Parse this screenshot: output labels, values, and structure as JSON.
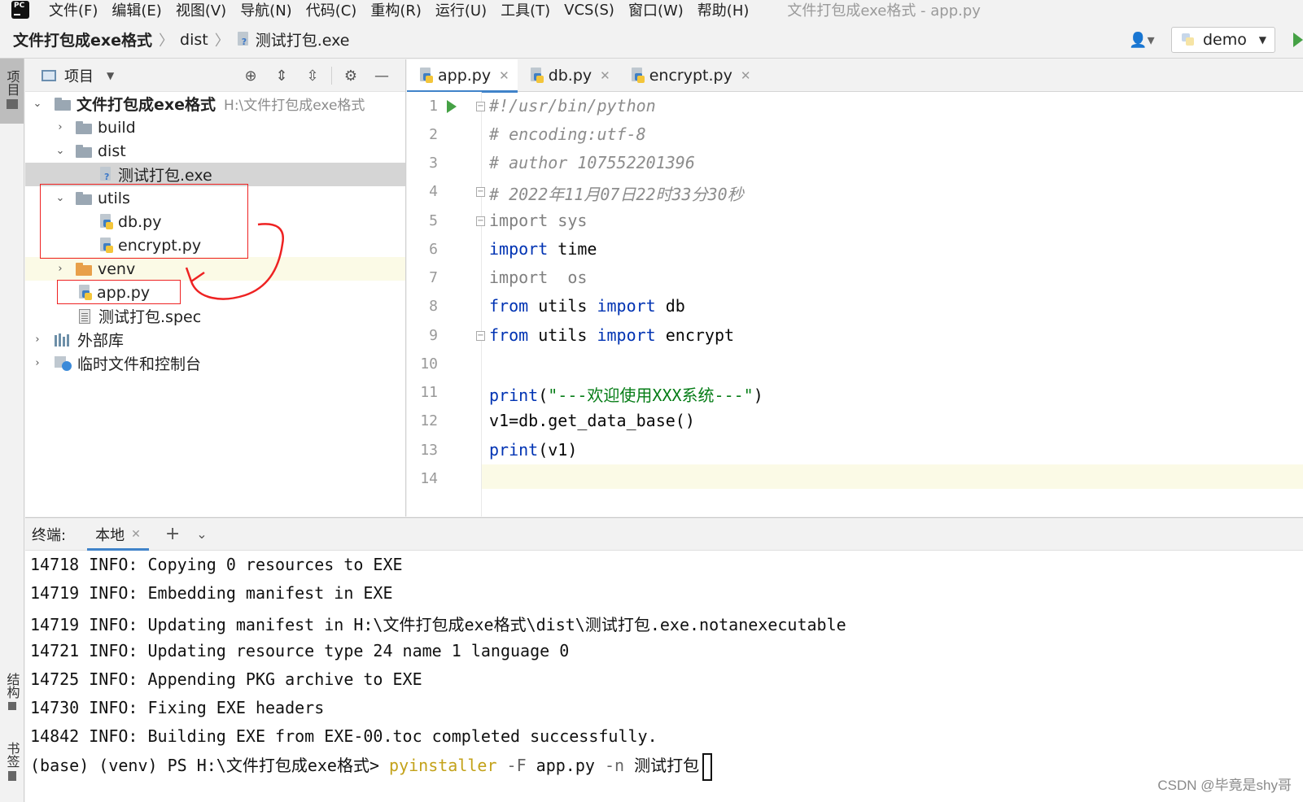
{
  "menu": {
    "logo_text": "PC",
    "items": [
      "文件(F)",
      "编辑(E)",
      "视图(V)",
      "导航(N)",
      "代码(C)",
      "重构(R)",
      "运行(U)",
      "工具(T)",
      "VCS(S)",
      "窗口(W)",
      "帮助(H)"
    ],
    "window_title": "文件打包成exe格式 - app.py"
  },
  "breadcrumb": {
    "project": "文件打包成exe格式",
    "folder": "dist",
    "file": "测试打包.exe"
  },
  "run_config": {
    "label": "demo"
  },
  "left_stripe": {
    "project_tab": "项目",
    "structure_tab": "结构",
    "bookmarks_tab": "书签"
  },
  "project_panel": {
    "title": "项目",
    "tree": [
      {
        "label": "文件打包成exe格式",
        "path": "H:\\文件打包成exe格式"
      },
      {
        "label": "build"
      },
      {
        "label": "dist"
      },
      {
        "label": "测试打包.exe"
      },
      {
        "label": "utils"
      },
      {
        "label": "db.py"
      },
      {
        "label": "encrypt.py"
      },
      {
        "label": "venv"
      },
      {
        "label": "app.py"
      },
      {
        "label": "测试打包.spec"
      },
      {
        "label": "外部库"
      },
      {
        "label": "临时文件和控制台"
      }
    ]
  },
  "editor": {
    "tabs": [
      {
        "label": "app.py",
        "active": true
      },
      {
        "label": "db.py",
        "active": false
      },
      {
        "label": "encrypt.py",
        "active": false
      }
    ],
    "line_numbers": [
      "1",
      "2",
      "3",
      "4",
      "5",
      "6",
      "7",
      "8",
      "9",
      "10",
      "11",
      "12",
      "13",
      "14"
    ],
    "code": {
      "l1": "#!/usr/bin/python",
      "l2": "# encoding:utf-8",
      "l3": "# author 107552201396",
      "l4": "# 2022年11月07日22时33分30秒",
      "l5_kw": "import",
      "l5_mod": " sys",
      "l6_kw": "import",
      "l6_mod": " time",
      "l7_kw": "import",
      "l7_mod": "  os",
      "l8_from": "from",
      "l8_mod": " utils ",
      "l8_import": "import",
      "l8_name": " db",
      "l9_from": "from",
      "l9_mod": " utils ",
      "l9_import": "import",
      "l9_name": " encrypt",
      "l11_fn": "print",
      "l11_open": "(",
      "l11_str": "\"---欢迎使用XXX系统---\"",
      "l11_close": ")",
      "l12": "v1=db.get_data_base()",
      "l13_fn": "print",
      "l13_arg": "(v1)"
    }
  },
  "terminal": {
    "label": "终端:",
    "tab": "本地",
    "lines": [
      "14718 INFO: Copying 0 resources to EXE",
      "14719 INFO: Embedding manifest in EXE",
      "14719 INFO: Updating manifest in H:\\文件打包成exe格式\\dist\\测试打包.exe.notanexecutable",
      "14721 INFO: Updating resource type 24 name 1 language 0",
      "14725 INFO: Appending PKG archive to EXE",
      "14730 INFO: Fixing EXE headers",
      "14842 INFO: Building EXE from EXE-00.toc completed successfully."
    ],
    "prompt": "(base) (venv) PS H:\\文件打包成exe格式> ",
    "cmd": "pyinstaller",
    "flag1": " -F",
    "arg1": " app.py",
    "flag2": " -n",
    "arg2": " 测试打包"
  },
  "watermark": "CSDN @毕竟是shy哥"
}
